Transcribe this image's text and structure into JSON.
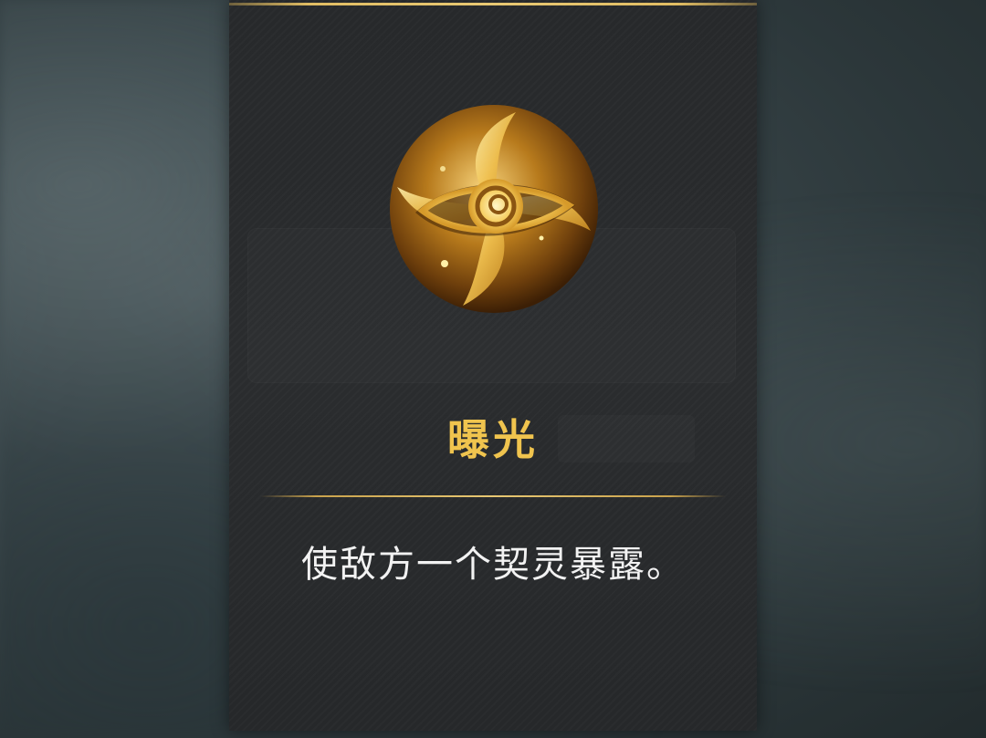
{
  "skill": {
    "name": "曝光",
    "description": "使敌方一个契灵暴露。",
    "icon": "golden-eye-icon"
  },
  "colors": {
    "accent_gold": "#f0c44e",
    "panel_bg": "#28292b",
    "text_light": "#f2f2f2"
  }
}
